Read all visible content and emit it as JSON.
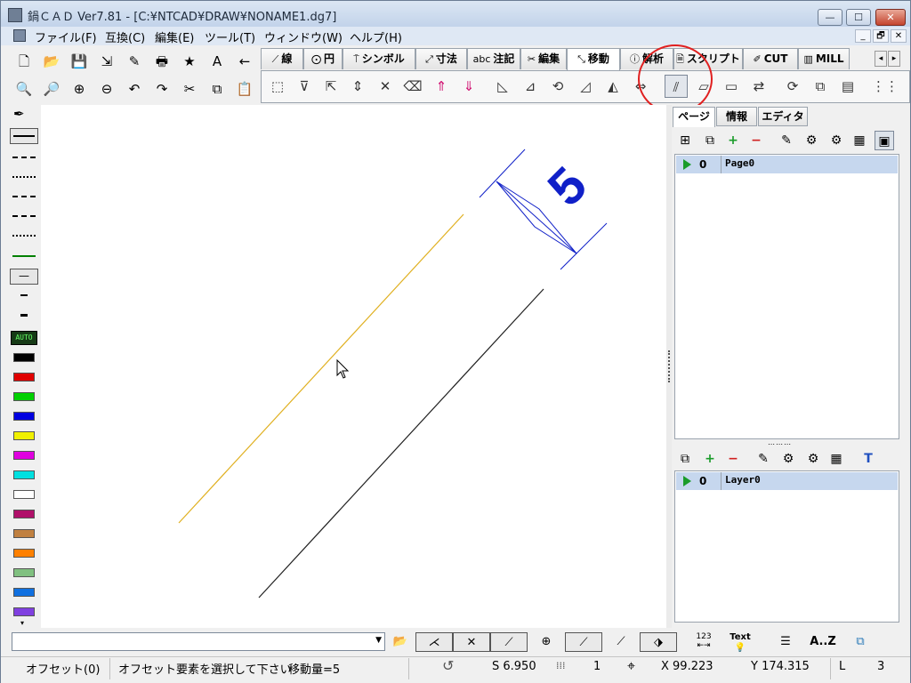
{
  "window": {
    "title": "鍋ＣＡＤ Ver7.81 - [C:¥NTCAD¥DRAW¥NONAME1.dg7]",
    "controls": {
      "minimize": "—",
      "maximize": "☐",
      "close": "✕"
    },
    "mdi_controls": [
      "_",
      "🗗",
      "✕"
    ]
  },
  "menu": [
    "ファイル(F)",
    "互換(C)",
    "編集(E)",
    "ツール(T)",
    "ウィンドウ(W)",
    "ヘルプ(H)"
  ],
  "toolbar_left_top": [
    "new-file-icon",
    "open-file-icon",
    "save-icon",
    "save-as-icon",
    "edit-doc-icon",
    "print-icon",
    "star-icon",
    "text-A-icon",
    "arrow-left-icon"
  ],
  "toolbar_left_top_glyphs": [
    "🗋",
    "📂",
    "💾",
    "⇲",
    "✎",
    "🖶",
    "★",
    "A",
    "←"
  ],
  "toolbar_left_bottom": [
    "zoom-window-icon",
    "zoom-all-icon",
    "zoom-in-icon",
    "zoom-out-icon",
    "undo-icon",
    "redo-icon",
    "cut-icon",
    "copy-icon",
    "paste-icon"
  ],
  "toolbar_left_bottom_glyphs": [
    "🔍",
    "🔎",
    "⊕",
    "⊖",
    "↶",
    "↷",
    "✂",
    "⧉",
    "📋"
  ],
  "tabs": [
    "線",
    "円",
    "シンボル",
    "寸法",
    "注記",
    "編集",
    "移動",
    "解析",
    "スクリプト",
    "CUT",
    "MILL"
  ],
  "tab_prefix": [
    "⟋",
    "⨀",
    "⍑",
    "⤢",
    "abc",
    "✂",
    "⤡",
    "ⓘ",
    "🗎",
    "✐",
    "▥"
  ],
  "active_tab": "移動",
  "tab_panel_icons": [
    "move-select-icon",
    "move-filter-icon",
    "move-copy-icon",
    "vertical-move-icon",
    "off-icon",
    "erase-icon",
    "mirror-top-icon",
    "mirror-bottom-icon",
    "rotate-icon",
    "scale-icon",
    "rotate-copy-icon",
    "slope-icon",
    "mirror-icon",
    "stretch-icon",
    "offset-parallel-icon",
    "offset-shape-icon",
    "page-icon",
    "connect-icon",
    "rotate-page-icon",
    "copy-page-icon",
    "layer-page-icon",
    "grid-icon"
  ],
  "tab_panel_glyphs": [
    "⬚",
    "⊽",
    "⇱",
    "⇕",
    "✕",
    "⌫",
    "⇑",
    "⇓",
    "◺",
    "⊿",
    "⟲",
    "◿",
    "◭",
    "⇔",
    "⫽",
    "▱",
    "▭",
    "⇄",
    "⟳",
    "⧉",
    "▤",
    "⋮⋮"
  ],
  "left_palette": {
    "auto_label": "AUTO",
    "colors": [
      "#000000",
      "#e00000",
      "#00d000",
      "#0000e0",
      "#f0f000",
      "#e000e0",
      "#00e0e0",
      "#ffffff",
      "#b0106a",
      "#c08040",
      "#ff8000",
      "#80c080",
      "#1070e0",
      "#8040e0"
    ]
  },
  "drawing": {
    "dimension_text": "5",
    "dimension_color": "#1020c8",
    "offset_line_color": "#e0b020",
    "base_line_color": "#202020"
  },
  "right_panel": {
    "tabs": [
      "ページ",
      "情報",
      "エディタ"
    ],
    "active_tab": "ページ",
    "page_rows": [
      {
        "num": "0",
        "name": "Page0"
      }
    ],
    "layer_rows": [
      {
        "num": "0",
        "name": "Layer0"
      }
    ],
    "page_toolbar_glyphs": [
      "⊞",
      "⧉",
      "+",
      "−",
      "✎",
      "⚙",
      "⚙",
      "▦",
      "▣"
    ],
    "layer_toolbar_glyphs": [
      "⧉",
      "+",
      "−",
      "✎",
      "⚙",
      "⚙",
      "▦",
      "T"
    ]
  },
  "bottom_bar": {
    "buttons": [
      "folder-icon",
      "snap-end-icon",
      "snap-intersection-icon",
      "snap-midpoint-icon",
      "snap-center-icon",
      "snap-point-icon",
      "snap-nearest-icon",
      "snap-tangent-icon",
      "measure-icon",
      "text-hint-icon",
      "align-icon",
      "sort-icon",
      "export-icon"
    ],
    "text_button": "Text",
    "sort_button": "A..Z",
    "measure_label": "123"
  },
  "status": {
    "mode": "オフセット(0)",
    "message": "オフセット要素を選択して下さい",
    "move_amount": "移動量=5",
    "scale": "S 6.950",
    "grid": "1",
    "x": "X 99.223",
    "y": "Y 174.315",
    "layer_label": "L",
    "layer_value": "3"
  }
}
